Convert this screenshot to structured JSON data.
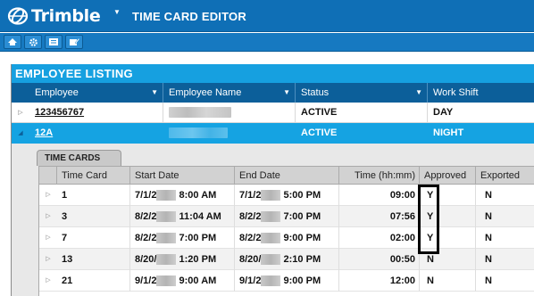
{
  "header": {
    "logo_text": "Trimble",
    "app_title": "TIME CARD EDITOR"
  },
  "toolbar": {
    "buttons": [
      "home-icon",
      "gear-icon",
      "card-list-icon",
      "edit-card-icon"
    ]
  },
  "employee_listing": {
    "title": "EMPLOYEE LISTING",
    "columns": [
      "Employee",
      "Employee Name",
      "Status",
      "Work Shift"
    ],
    "rows": [
      {
        "employee": "123456767",
        "employee_name": "",
        "status": "ACTIVE",
        "work_shift": "DAY",
        "selected": false
      },
      {
        "employee": "12A",
        "employee_name": "",
        "status": "ACTIVE",
        "work_shift": "NIGHT",
        "selected": true
      }
    ]
  },
  "time_cards": {
    "tab_label": "TIME CARDS",
    "columns": [
      "Time Card",
      "Start Date",
      "End Date",
      "Time (hh:mm)",
      "Approved",
      "Exported"
    ],
    "rows": [
      {
        "card": "1",
        "start_a": "7/1/2",
        "start_b": "8:00 AM",
        "end_a": "7/1/2",
        "end_b": "5:00 PM",
        "time": "09:00",
        "approved": "Y",
        "exported": "N"
      },
      {
        "card": "3",
        "start_a": "8/2/2",
        "start_b": "11:04 AM",
        "end_a": "8/2/2",
        "end_b": "7:00 PM",
        "time": "07:56",
        "approved": "Y",
        "exported": "N"
      },
      {
        "card": "7",
        "start_a": "8/2/2",
        "start_b": "7:00 PM",
        "end_a": "8/2/2",
        "end_b": "9:00 PM",
        "time": "02:00",
        "approved": "Y",
        "exported": "N"
      },
      {
        "card": "13",
        "start_a": "8/20/",
        "start_b": "1:20 PM",
        "end_a": "8/20/",
        "end_b": "2:10 PM",
        "time": "00:50",
        "approved": "N",
        "exported": "N"
      },
      {
        "card": "21",
        "start_a": "9/1/2",
        "start_b": "9:00 AM",
        "end_a": "9/1/2",
        "end_b": "9:00 PM",
        "time": "12:00",
        "approved": "N",
        "exported": "N"
      }
    ]
  },
  "colors": {
    "header_blue": "#0f6fb6",
    "panel_title_blue": "#16a0e0",
    "column_header_navy": "#0c5f9a",
    "selected_row_blue": "#15a3e2"
  }
}
